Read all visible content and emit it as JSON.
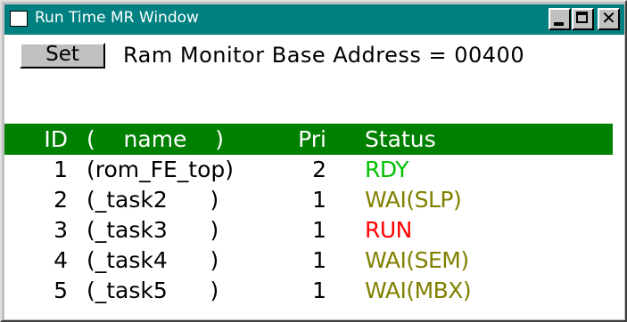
{
  "window": {
    "title": "Run Time MR Window",
    "controls": {
      "minimize_icon": "minimize-icon",
      "maximize_icon": "maximize-icon",
      "close_icon": "close-icon"
    }
  },
  "toolbar": {
    "set_label": "Set",
    "base_address_text": "Ram Monitor Base Address = 00400"
  },
  "table": {
    "headers": {
      "id": "ID",
      "name": "(    name    )",
      "pri": "Pri",
      "status": "Status"
    },
    "rows": [
      {
        "id": "1",
        "name": "(rom_FE_top)",
        "pri": "2",
        "status": "RDY",
        "status_color": "#00c000"
      },
      {
        "id": "2",
        "name": "(_task2      )",
        "pri": "1",
        "status": "WAI(SLP)",
        "status_color": "#808000"
      },
      {
        "id": "3",
        "name": "(_task3      )",
        "pri": "1",
        "status": "RUN",
        "status_color": "#ff0000"
      },
      {
        "id": "4",
        "name": "(_task4      )",
        "pri": "1",
        "status": "WAI(SEM)",
        "status_color": "#808000"
      },
      {
        "id": "5",
        "name": "(_task5      )",
        "pri": "1",
        "status": "WAI(MBX)",
        "status_color": "#808000"
      }
    ]
  },
  "colors": {
    "title_bar": "#008080",
    "header_bar": "#008000",
    "frame": "#c0c0c0"
  }
}
